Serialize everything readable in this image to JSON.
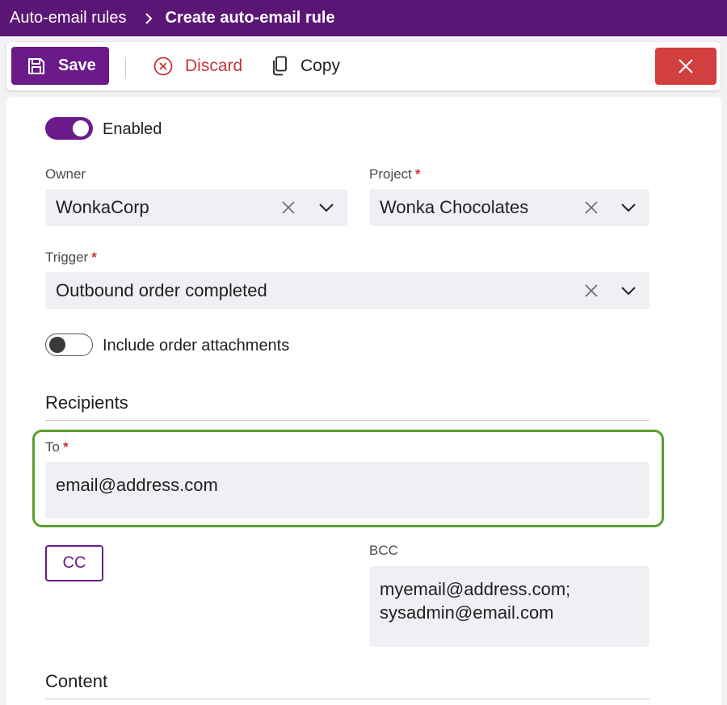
{
  "breadcrumb": {
    "parent": "Auto-email rules",
    "current": "Create auto-email rule"
  },
  "toolbar": {
    "save_label": "Save",
    "discard_label": "Discard",
    "copy_label": "Copy",
    "close_icon": "close-icon"
  },
  "form": {
    "enabled_label": "Enabled",
    "enabled": true,
    "owner": {
      "label": "Owner",
      "value": "WonkaCorp"
    },
    "project": {
      "label": "Project",
      "required_mark": "*",
      "value": "Wonka Chocolates"
    },
    "trigger": {
      "label": "Trigger",
      "required_mark": "*",
      "value": "Outbound order completed"
    },
    "include_attachments_label": "Include order attachments",
    "include_attachments": false
  },
  "recipients": {
    "title": "Recipients",
    "to": {
      "label": "To",
      "required_mark": "*",
      "value": "email@address.com"
    },
    "cc_button_label": "CC",
    "bcc": {
      "label": "BCC",
      "lines": [
        "myemail@address.com;",
        "sysadmin@email.com"
      ]
    }
  },
  "content": {
    "title": "Content"
  },
  "colors": {
    "header_bg": "#5b1574",
    "accent": "#6b1a8a",
    "danger": "#d13f3f",
    "highlight": "#5aa02c"
  }
}
